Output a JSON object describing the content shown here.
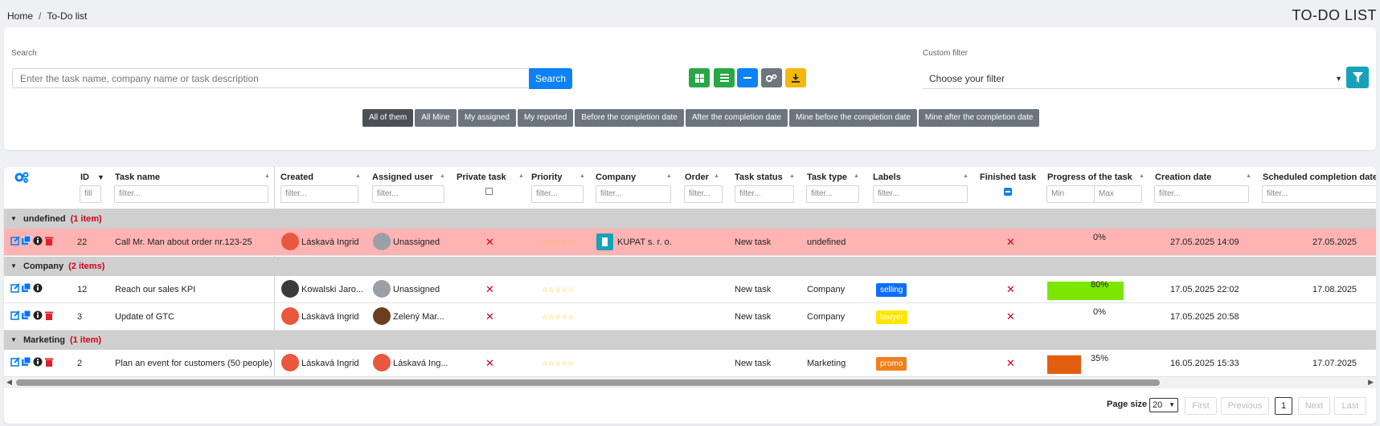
{
  "breadcrumb": {
    "home": "Home",
    "current": "To-Do list"
  },
  "page_title": "TO-DO LIST",
  "search": {
    "label": "Search",
    "placeholder": "Enter the task name, company name or task description",
    "button": "Search"
  },
  "custom_filter": {
    "label": "Custom filter",
    "value": "Choose your filter"
  },
  "filter_tabs": [
    "All of them",
    "All Mine",
    "My assigned",
    "My reported",
    "Before the completion date",
    "After the completion date",
    "Mine before the completion date",
    "Mine after the completion date"
  ],
  "columns": {
    "id": "ID",
    "task_name": "Task name",
    "created": "Created",
    "assigned": "Assigned user",
    "private": "Private task",
    "priority": "Priority",
    "company": "Company",
    "order": "Order",
    "status": "Task status",
    "type": "Task type",
    "labels": "Labels",
    "finished": "Finished task",
    "progress": "Progress of the task",
    "creation_date": "Creation date",
    "scheduled": "Scheduled completion date"
  },
  "filters": {
    "id": "fill",
    "generic": "filter...",
    "min": "Min",
    "max": "Max"
  },
  "groups": [
    {
      "name": "undefined",
      "count": "(1 item)"
    },
    {
      "name": "Company",
      "count": "(2 items)"
    },
    {
      "name": "Marketing",
      "count": "(1 item)"
    }
  ],
  "rows": [
    {
      "id": "22",
      "task": "Call Mr. Man about order nr.123-25",
      "created": "Láskavá Ingrid",
      "assigned": "Unassigned",
      "priority": "☆☆☆☆☆",
      "company": "KUPAT s. r. o.",
      "status": "New task",
      "type": "undefined",
      "label": "",
      "progress_text": "0%",
      "progress": 0,
      "creation_date": "27.05.2025 14:09",
      "scheduled": "27.05.2025"
    },
    {
      "id": "12",
      "task": "Reach our sales KPI",
      "created": "Kowalski Jaro...",
      "assigned": "Unassigned",
      "priority": "☆☆☆☆☆",
      "company": "",
      "status": "New task",
      "type": "Company",
      "label": "selling",
      "progress_text": "80%",
      "progress": 80,
      "creation_date": "17.05.2025 22:02",
      "scheduled": "17.08.2025"
    },
    {
      "id": "3",
      "task": "Update of GTC",
      "created": "Láskavá Ingrid",
      "assigned": "Zelený Mar...",
      "priority": "☆☆☆☆☆",
      "company": "",
      "status": "New task",
      "type": "Company",
      "label": "lawyer",
      "progress_text": "0%",
      "progress": 0,
      "creation_date": "17.05.2025 20:58",
      "scheduled": ""
    },
    {
      "id": "2",
      "task": "Plan an event for customers (50 people)",
      "created": "Láskavá Ingrid",
      "assigned": "Láskavá Ing...",
      "priority": "☆☆☆☆☆",
      "company": "",
      "status": "New task",
      "type": "Marketing",
      "label": "promo",
      "progress_text": "35%",
      "progress": 35,
      "creation_date": "16.05.2025 15:33",
      "scheduled": "17.07.2025"
    }
  ],
  "label_colors": {
    "selling": "#0d6efd",
    "lawyer": "#ffe600",
    "promo": "#f07f1d"
  },
  "progress_colors": {
    "80": "#7be600",
    "35": "#e35d0e"
  },
  "pager": {
    "page_size_label": "Page size",
    "page_size": "20",
    "first": "First",
    "previous": "Previous",
    "current": "1",
    "next": "Next",
    "last": "Last"
  }
}
